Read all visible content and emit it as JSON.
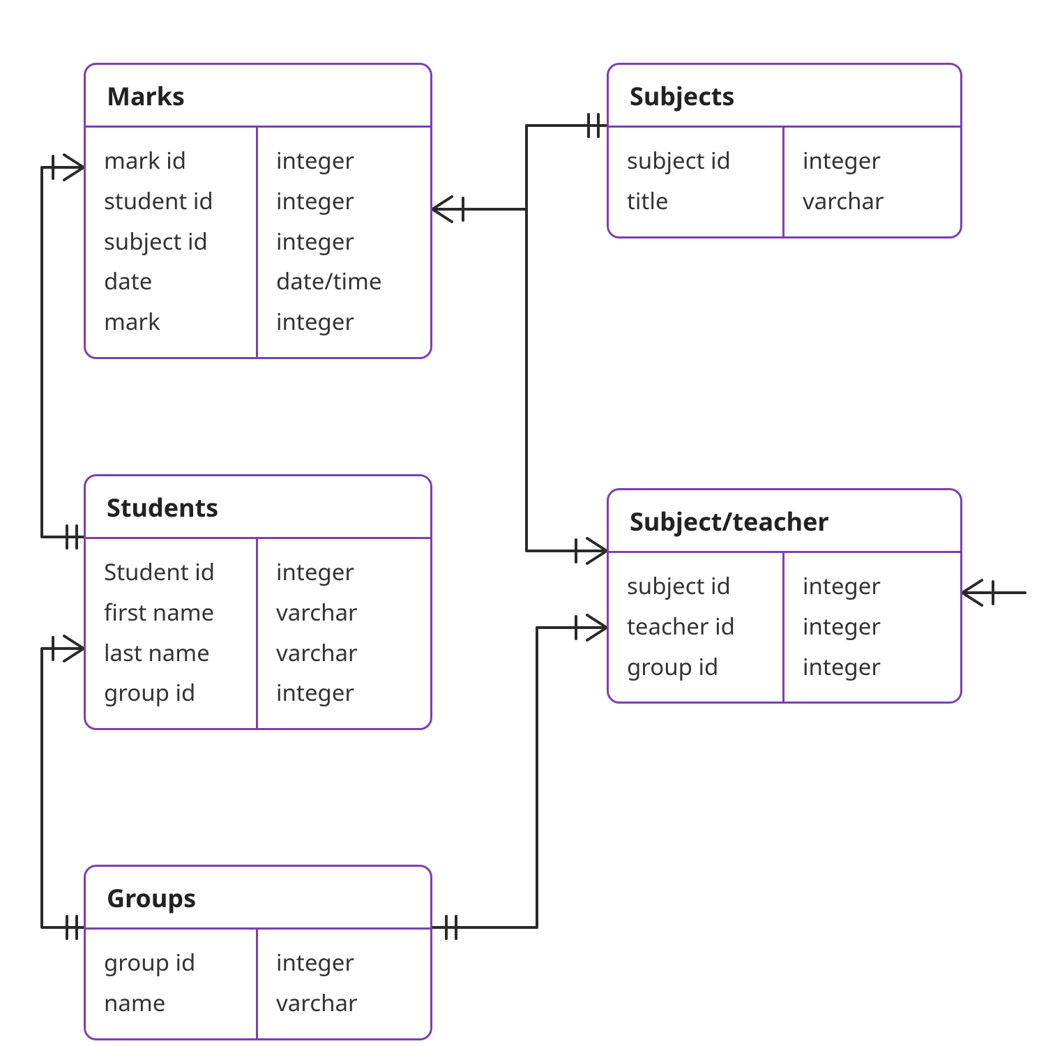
{
  "entities": {
    "marks": {
      "title": "Marks",
      "fields": [
        {
          "name": "mark id",
          "type": "integer"
        },
        {
          "name": "student id",
          "type": "integer"
        },
        {
          "name": "subject id",
          "type": "integer"
        },
        {
          "name": "date",
          "type": "date/time"
        },
        {
          "name": "mark",
          "type": "integer"
        }
      ]
    },
    "subjects": {
      "title": "Subjects",
      "fields": [
        {
          "name": "subject id",
          "type": "integer"
        },
        {
          "name": "title",
          "type": "varchar"
        }
      ]
    },
    "students": {
      "title": "Students",
      "fields": [
        {
          "name": "Student id",
          "type": "integer"
        },
        {
          "name": "first name",
          "type": "varchar"
        },
        {
          "name": "last name",
          "type": "varchar"
        },
        {
          "name": "group id",
          "type": "integer"
        }
      ]
    },
    "subject_teacher": {
      "title": "Subject/teacher",
      "fields": [
        {
          "name": "subject id",
          "type": "integer"
        },
        {
          "name": "teacher id",
          "type": "integer"
        },
        {
          "name": "group id",
          "type": "integer"
        }
      ]
    },
    "groups": {
      "title": "Groups",
      "fields": [
        {
          "name": "group id",
          "type": "integer"
        },
        {
          "name": "name",
          "type": "varchar"
        }
      ]
    }
  },
  "colors": {
    "entity_border": "#7b3fb3",
    "connector": "#2a2a2a"
  }
}
